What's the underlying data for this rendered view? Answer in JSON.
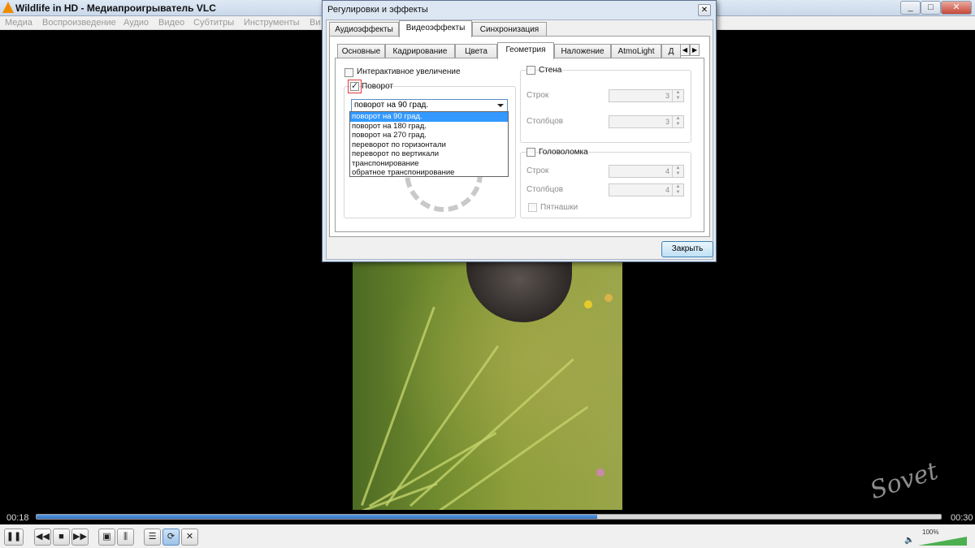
{
  "window": {
    "title": "Wildlife in HD - Медиапроигрыватель VLC"
  },
  "menu": [
    "Медиа",
    "Воспроизведение",
    "Аудио",
    "Видео",
    "Субтитры",
    "Инструменты",
    "Ви"
  ],
  "dialog": {
    "title": "Регулировки и эффекты",
    "top_tabs": [
      "Аудиоэффекты",
      "Видеоэффекты",
      "Синхронизация"
    ],
    "sub_tabs": [
      "Основные",
      "Кадрирование",
      "Цвета",
      "Геометрия",
      "Наложение",
      "AtmoLight",
      "Д"
    ],
    "interactive_zoom_label": "Интерактивное увеличение",
    "rotate_label": "Поворот",
    "rotate_combo_value": "поворот на 90 град.",
    "rotate_options": [
      "поворот на 90 град.",
      "поворот на 180 град.",
      "поворот на 270 град.",
      "переворот по горизонтали",
      "переворот по вертикали",
      "транспонирование",
      "обратное транспонирование"
    ],
    "wall": {
      "label": "Стена",
      "rows_label": "Строк",
      "rows_value": "3",
      "cols_label": "Столбцов",
      "cols_value": "3"
    },
    "puzzle": {
      "label": "Головоломка",
      "rows_label": "Строк",
      "rows_value": "4",
      "cols_label": "Столбцов",
      "cols_value": "4",
      "fifteen_label": "Пятнашки"
    },
    "close_button": "Закрыть"
  },
  "player": {
    "time_elapsed": "00:18",
    "time_total": "00:30",
    "progress": 0.62,
    "volume": "100%"
  },
  "watermark": "Sovet"
}
